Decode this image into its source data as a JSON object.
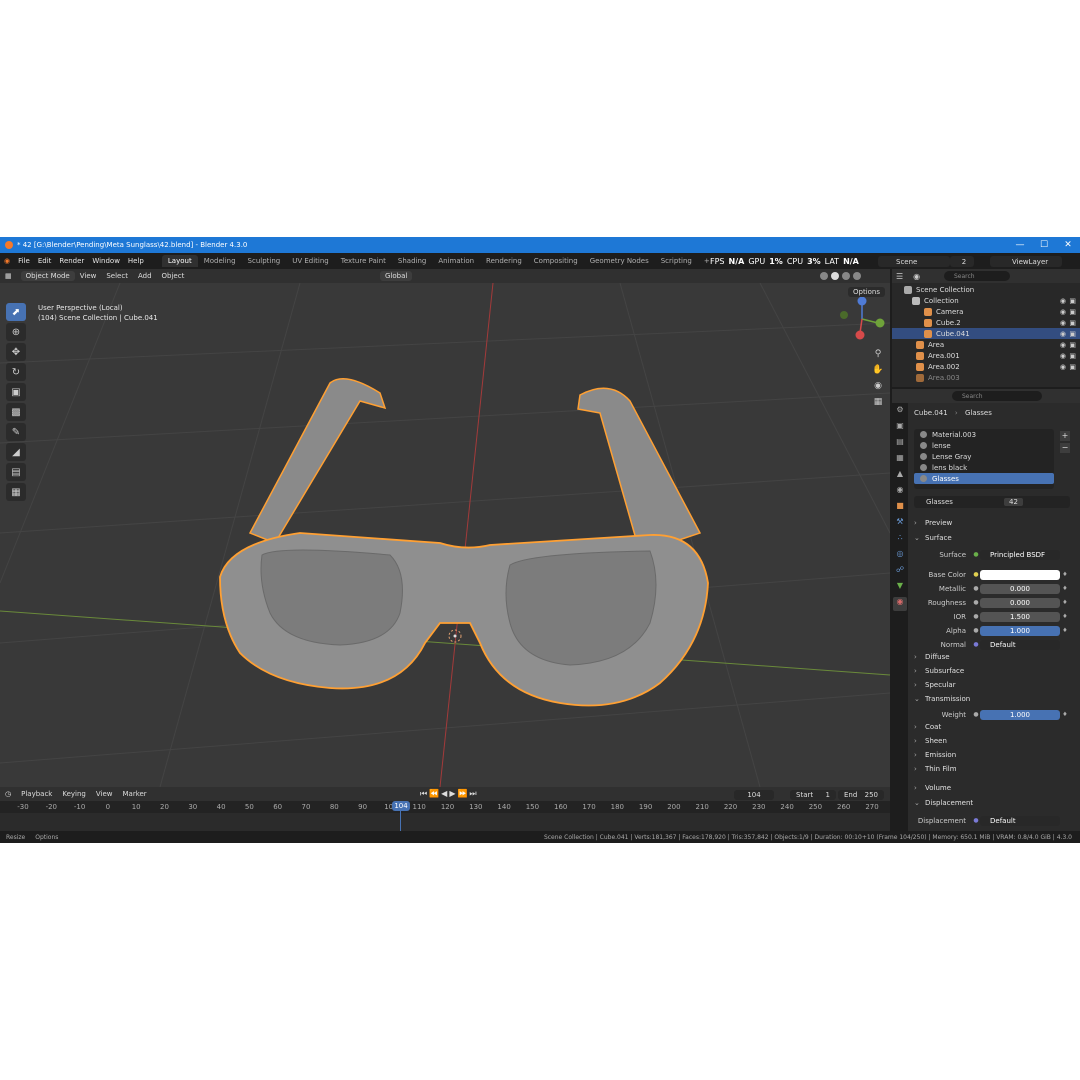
{
  "title": "* 42 [G:\\Blender\\Pending\\Meta Sunglass\\42.blend] - Blender 4.3.0",
  "menu": [
    "File",
    "Edit",
    "Render",
    "Window",
    "Help"
  ],
  "workspaces": [
    "Layout",
    "Modeling",
    "Sculpting",
    "UV Editing",
    "Texture Paint",
    "Shading",
    "Animation",
    "Rendering",
    "Compositing",
    "Geometry Nodes",
    "Scripting",
    "+"
  ],
  "active_workspace": "Layout",
  "perf": {
    "fps_label": "FPS",
    "fps": "N/A",
    "gpu_label": "GPU",
    "gpu": "1%",
    "cpu_label": "CPU",
    "cpu": "3%",
    "lat_label": "LAT",
    "lat": "N/A"
  },
  "scene": {
    "name": "Scene",
    "users": "2",
    "view_layer": "ViewLayer"
  },
  "viewport_header": {
    "mode": "Object Mode",
    "view": "View",
    "select": "Select",
    "add": "Add",
    "object": "Object",
    "orientation": "Global",
    "options": "Options"
  },
  "viewport": {
    "line1": "User Perspective (Local)",
    "line2": "(104) Scene Collection | Cube.041"
  },
  "outliner": {
    "search_placeholder": "Search",
    "rows": [
      {
        "label": "Scene Collection"
      },
      {
        "label": "Collection"
      },
      {
        "label": "Camera"
      },
      {
        "label": "Cube.2"
      },
      {
        "label": "Cube.041"
      },
      {
        "label": "Area"
      },
      {
        "label": "Area.001"
      },
      {
        "label": "Area.002"
      },
      {
        "label": "Area.003"
      }
    ]
  },
  "properties": {
    "search_placeholder": "Search",
    "breadcrumb_object": "Cube.041",
    "breadcrumb_material": "Glasses",
    "materials": [
      "Material.003",
      "lense",
      "Lense Gray",
      "lens black",
      "Glasses"
    ],
    "material_name": "Glasses",
    "material_users": "42",
    "panels": {
      "preview": "Preview",
      "surface": "Surface",
      "diffuse": "Diffuse",
      "subsurface": "Subsurface",
      "specular": "Specular",
      "transmission": "Transmission",
      "coat": "Coat",
      "sheen": "Sheen",
      "emission": "Emission",
      "thin_film": "Thin Film",
      "volume": "Volume",
      "displacement": "Displacement"
    },
    "surface_label": "Surface",
    "surface_value": "Principled BSDF",
    "base_color_label": "Base Color",
    "base_color": "#ffffff",
    "metallic_label": "Metallic",
    "metallic": "0.000",
    "roughness_label": "Roughness",
    "roughness": "0.000",
    "ior_label": "IOR",
    "ior": "1.500",
    "alpha_label": "Alpha",
    "alpha": "1.000",
    "normal_label": "Normal",
    "normal": "Default",
    "weight_label": "Weight",
    "weight": "1.000",
    "displacement_label": "Displacement",
    "displacement": "Default"
  },
  "timeline": {
    "menus": [
      "Playback",
      "Keying",
      "View",
      "Marker"
    ],
    "current_frame": "104",
    "start_label": "Start",
    "start": "1",
    "end_label": "End",
    "end": "250",
    "ticks": [
      "-30",
      "-20",
      "-10",
      "0",
      "10",
      "20",
      "30",
      "40",
      "50",
      "60",
      "70",
      "80",
      "90",
      "100",
      "110",
      "120",
      "130",
      "140",
      "150",
      "160",
      "170",
      "180",
      "190",
      "200",
      "210",
      "220",
      "230",
      "240",
      "250",
      "260",
      "270"
    ]
  },
  "statusbar": {
    "resize": "Resize",
    "options": "Options",
    "info": "Scene Collection | Cube.041 | Verts:181,367 | Faces:178,920 | Tris:357,842 | Objects:1/9 | Duration: 00:10+10 (Frame 104/250) | Memory: 650.1 MiB | VRAM: 0.8/4.0 GiB | 4.3.0"
  },
  "colors": {
    "accent": "#4772b3",
    "selection_outline": "#ffa033",
    "titlebar": "#1e78d6"
  }
}
